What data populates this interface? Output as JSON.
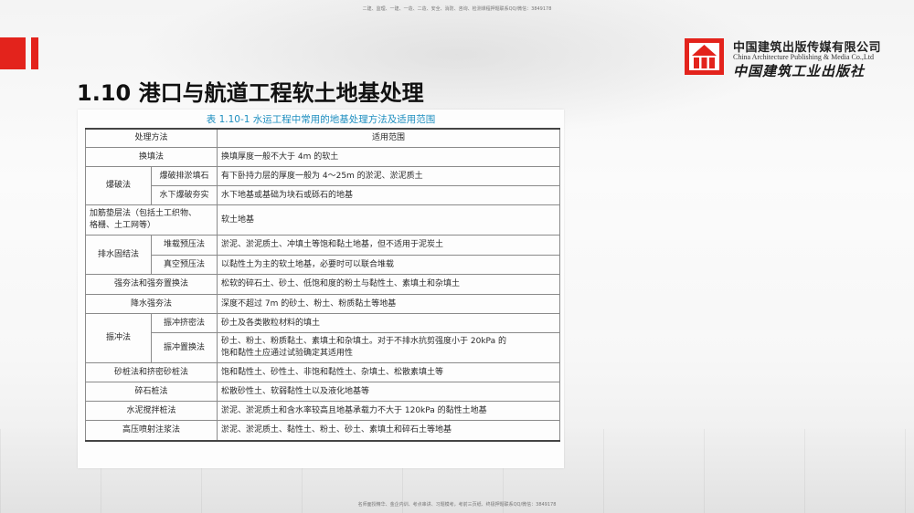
{
  "header": {
    "top_note": "二建、监理、一建、一造、二造、安全、消防、咨询、检测课程押题联系QQ/微信：3849178",
    "bottom_note": "名师面授精华、金企内训、考点串讲、习题模考，考前三页纸、终极押题联系QQ/微信：3849178"
  },
  "brand": {
    "name_cn": "中国建筑出版传媒有限公司",
    "name_en": "China Architecture Publishing & Media Co.,Ltd",
    "name_cn2": "中国建筑工业出版社",
    "accent_color": "#e3231c"
  },
  "slide": {
    "title": "1.10  港口与航道工程软土地基处理"
  },
  "table": {
    "caption": "表 1.10-1   水运工程中常用的地基处理方法及适用范围",
    "headers": [
      "处理方法",
      "适用范围"
    ],
    "rows": {
      "r1": {
        "method": "换填法",
        "scope": "换填厚度一般不大于 4m 的软土"
      },
      "r2": {
        "group": "爆破法",
        "method": "爆破排淤填石",
        "scope": "有下卧持力层的厚度一般为 4～25m 的淤泥、淤泥质土"
      },
      "r3": {
        "method": "水下爆破夯实",
        "scope": "水下地基或基础为块石或砾石的地基"
      },
      "r4": {
        "method_line1": "加筋垫层法（包括土工织物、",
        "method_line2": "格栅、土工网等）",
        "scope": "软土地基"
      },
      "r5": {
        "group": "排水固结法",
        "method": "堆载预压法",
        "scope": "淤泥、淤泥质土、冲填土等饱和黏土地基，但不适用于泥炭土"
      },
      "r6": {
        "method": "真空预压法",
        "scope": "以黏性土为主的软土地基，必要时可以联合堆载"
      },
      "r7": {
        "method": "强夯法和强夯置换法",
        "scope": "松软的碎石土、砂土、低饱和度的粉土与黏性土、素填土和杂填土"
      },
      "r8": {
        "method": "降水强夯法",
        "scope": "深度不超过 7m 的砂土、粉土、粉质黏土等地基"
      },
      "r9": {
        "group": "振冲法",
        "method": "振冲挤密法",
        "scope": "砂土及各类散粒材料的填土"
      },
      "r10": {
        "method": "振冲置换法",
        "scope_line1": "砂土、粉土、粉质黏土、素填土和杂填土。对于不排水抗剪强度小于 20kPa 的",
        "scope_line2": "饱和黏性土应通过试验确定其适用性"
      },
      "r11": {
        "method": "砂桩法和挤密砂桩法",
        "scope": "饱和黏性土、砂性土、非饱和黏性土、杂填土、松散素填土等"
      },
      "r12": {
        "method": "碎石桩法",
        "scope": "松散砂性土、软弱黏性土以及液化地基等"
      },
      "r13": {
        "method": "水泥搅拌桩法",
        "scope": "淤泥、淤泥质土和含水率较高且地基承载力不大于 120kPa 的黏性土地基"
      },
      "r14": {
        "method": "高压喷射注浆法",
        "scope": "淤泥、淤泥质土、黏性土、粉土、砂土、素填土和碎石土等地基"
      }
    }
  }
}
